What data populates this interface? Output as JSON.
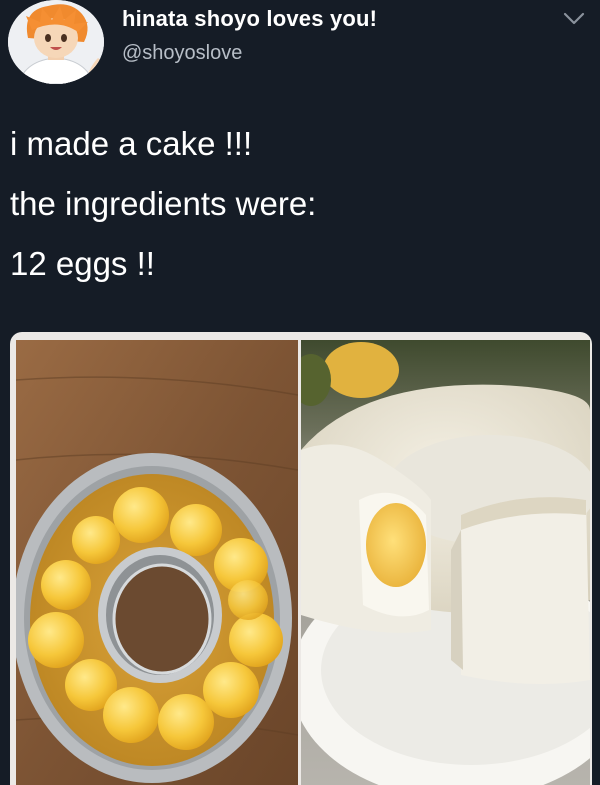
{
  "tweet": {
    "display_name": "hinata shoyo loves you!",
    "handle": "@shoyoslove",
    "lines": [
      "i made a cake !!!",
      "the ingredients were:",
      "12 eggs !!"
    ]
  },
  "icons": {
    "avatar": "anime-avatar",
    "menu": "chevron-down-icon"
  },
  "media": {
    "photos": [
      "eggs-in-bundt-pan",
      "egg-cake-slice"
    ]
  },
  "colors": {
    "background": "#151c26",
    "text": "#ffffff",
    "handle": "#b7bec7"
  }
}
